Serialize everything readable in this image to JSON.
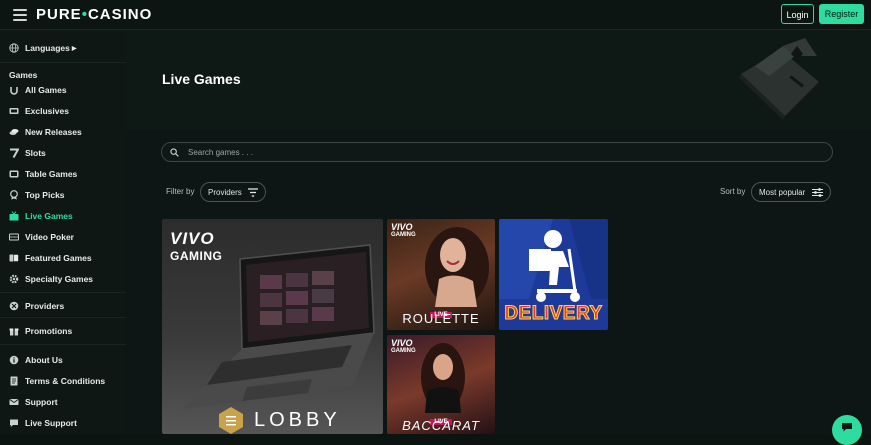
{
  "header": {
    "logo_left": "PURE",
    "logo_right": "CASINO",
    "login_label": "Login",
    "register_label": "Register"
  },
  "sidebar": {
    "languages": "Languages",
    "games_heading": "Games",
    "items": [
      {
        "label": "All Games",
        "icon": "horseshoe-icon"
      },
      {
        "label": "Exclusives",
        "icon": "ticket-icon"
      },
      {
        "label": "New Releases",
        "icon": "chip-stack-icon"
      },
      {
        "label": "Slots",
        "icon": "seven-icon"
      },
      {
        "label": "Table Games",
        "icon": "table-icon"
      },
      {
        "label": "Top Picks",
        "icon": "trophy-icon"
      },
      {
        "label": "Live Games",
        "icon": "live-icon",
        "active": true
      },
      {
        "label": "Video Poker",
        "icon": "video-icon"
      },
      {
        "label": "Featured Games",
        "icon": "cards-icon"
      },
      {
        "label": "Specialty Games",
        "icon": "gear-icon"
      }
    ],
    "providers": "Providers",
    "promotions": "Promotions",
    "footer_items": [
      {
        "label": "About Us",
        "icon": "info-icon"
      },
      {
        "label": "Terms & Conditions",
        "icon": "document-icon"
      },
      {
        "label": "Support",
        "icon": "support-icon"
      },
      {
        "label": "Live Support",
        "icon": "chat-icon"
      }
    ]
  },
  "main": {
    "title": "Live Games",
    "search_placeholder": "Search games . . .",
    "filter_label": "Filter by",
    "filter_value": "Providers",
    "sort_label": "Sort by",
    "sort_value": "Most popular"
  },
  "tiles": {
    "lobby": {
      "brand_top": "VIVO",
      "brand_bottom": "GAMING",
      "label": "LOBBY"
    },
    "roulette": {
      "brand_top": "VIVO",
      "brand_bottom": "GAMING",
      "tag": "LIVE",
      "label": "ROULETTE"
    },
    "delivery": {
      "label": "DELIVERY"
    },
    "baccarat": {
      "brand_top": "VIVO",
      "brand_bottom": "GAMING",
      "tag": "LIVE",
      "label": "BACCARAT"
    }
  },
  "colors": {
    "accent": "#2ddc9e",
    "background": "#0c1412",
    "sidebar": "#0f1715"
  }
}
